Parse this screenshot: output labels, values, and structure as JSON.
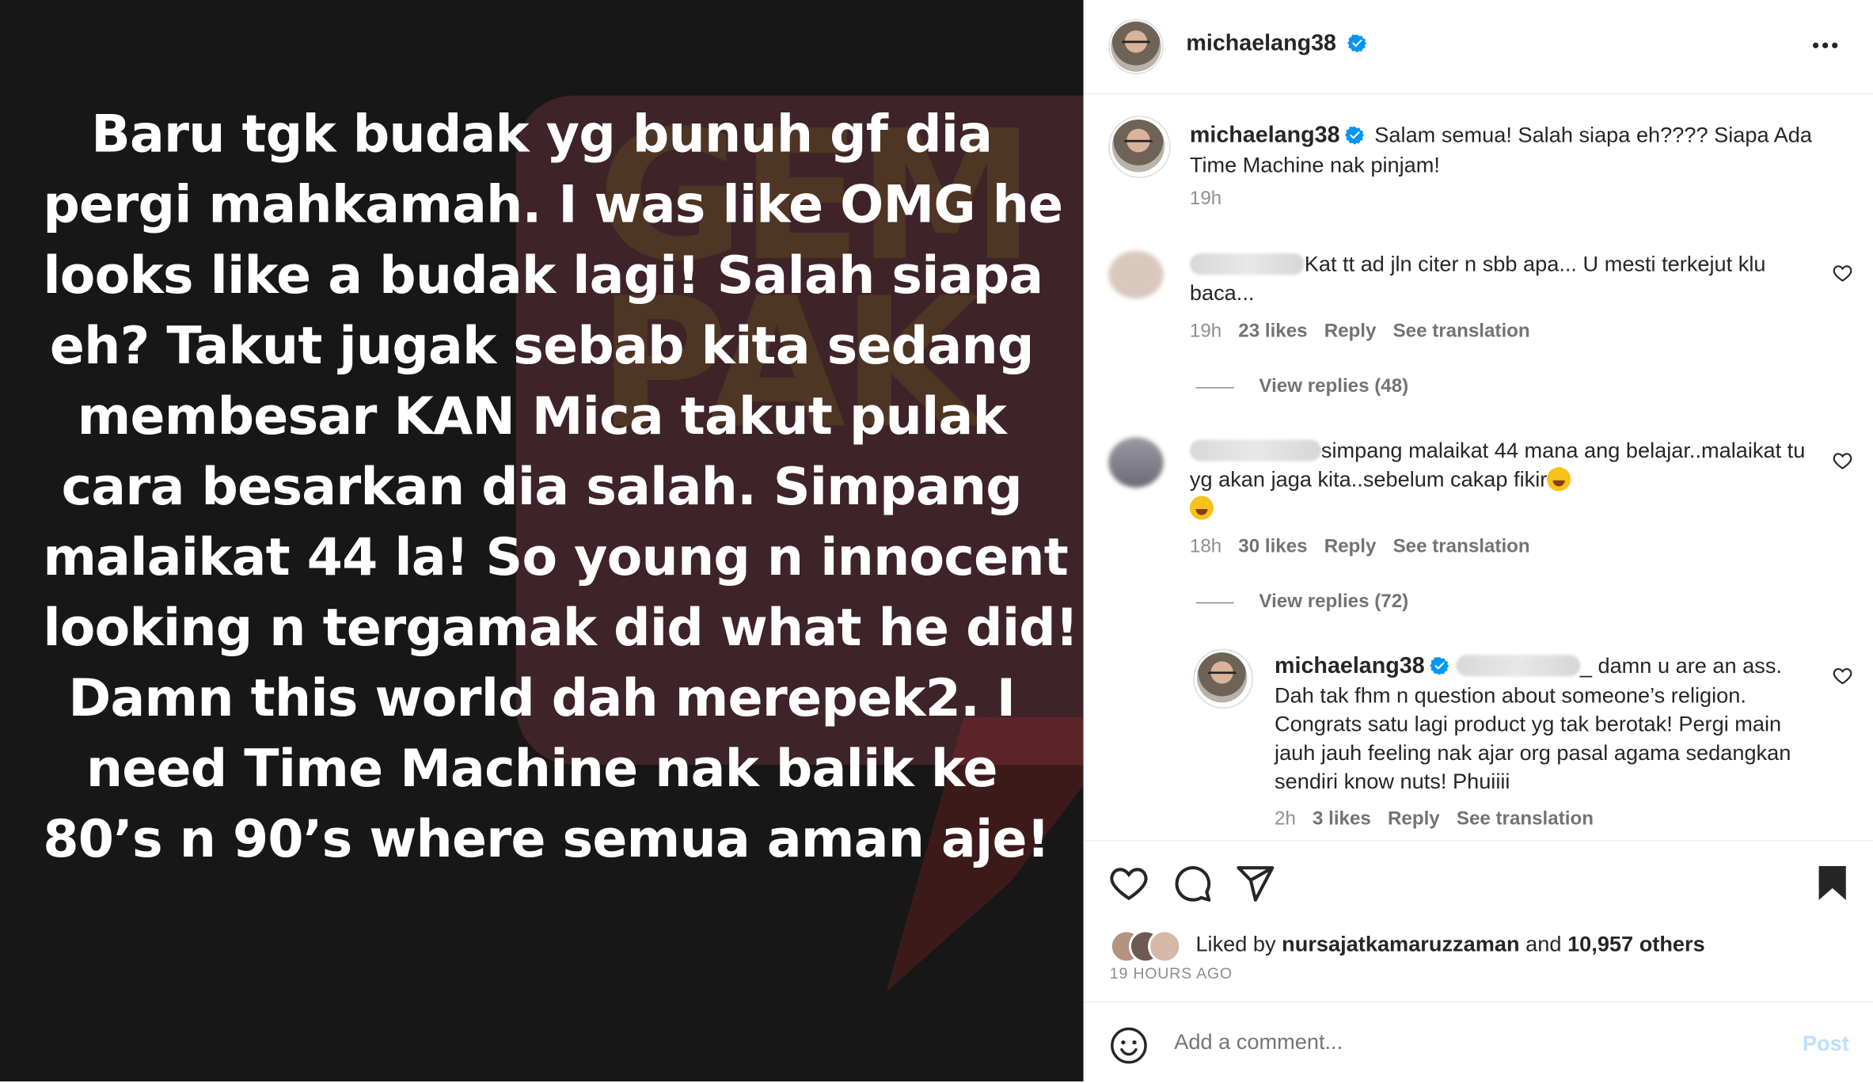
{
  "post_image": {
    "watermark_letters": "GEM PAK",
    "lines": [
      "Baru tgk budak yg bunuh gf dia",
      "pergi mahkamah. I was like OMG he",
      "looks like a budak lagi! Salah siapa",
      "eh? Takut jugak sebab kita sedang",
      "membesar KAN Mica takut pulak",
      "cara besarkan dia salah. Simpang",
      "malaikat 44 la! So young n innocent",
      "looking n tergamak did what he did!",
      "Damn this world dah merepek2. I",
      "need Time Machine nak balik ke",
      "80’s n 90’s where semua aman aje!"
    ]
  },
  "header": {
    "username": "michaelang38",
    "more_icon": "more-horizontal-icon"
  },
  "caption": {
    "username": "michaelang38",
    "text": "Salam semua! Salah siapa eh???? Siapa Ada Time Machine nak pinjam!",
    "time": "19h"
  },
  "comments": [
    {
      "text": "Kat tt ad jln citer n sbb apa... U mesti terkejut klu baca...",
      "time": "19h",
      "likes": "23 likes",
      "reply": "Reply",
      "translate": "See translation",
      "view_replies": "View replies (48)"
    },
    {
      "text": "simpang malaikat 44 mana ang belajar..malaikat tu yg akan jaga kita..sebelum cakap fikir",
      "time": "18h",
      "likes": "30 likes",
      "reply": "Reply",
      "translate": "See translation",
      "view_replies": "View replies (72)"
    }
  ],
  "reply": {
    "username": "michaelang38",
    "text_suffix": "_ damn u are an ass. Dah tak fhm n question about someone’s religion. Congrats satu lagi product yg tak berotak! Pergi main jauh jauh feeling nak ajar org pasal agama sedangkan sendiri know nuts! Phuiiii",
    "time": "2h",
    "likes": "3 likes",
    "reply": "Reply",
    "translate": "See translation"
  },
  "actions": {
    "liked_prefix": "Liked by",
    "liked_user": "nursajatkamaruzzaman",
    "liked_and": "and",
    "liked_count": "10,957 others",
    "time_ago": "19 HOURS AGO"
  },
  "comment_box": {
    "placeholder": "Add a comment...",
    "post_label": "Post"
  },
  "colors": {
    "text": "#262626",
    "secondary": "#8e8e8e",
    "verified": "#0095f6",
    "post_disabled": "#c0dffd",
    "image_bg": "#171717"
  }
}
